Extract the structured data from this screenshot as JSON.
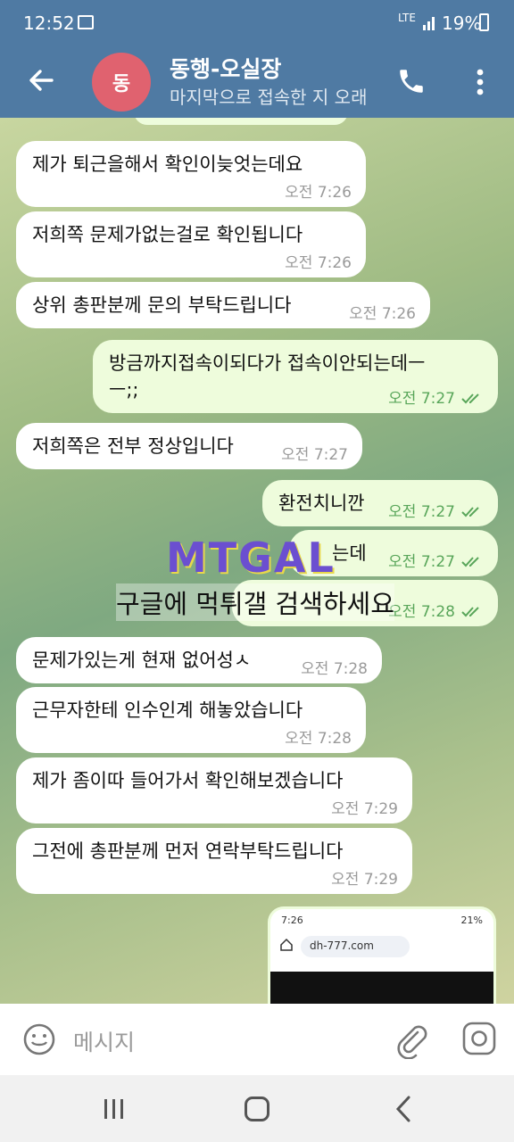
{
  "status_bar": {
    "time": "12:52",
    "network": "LTE",
    "battery": "19%"
  },
  "header": {
    "avatar_letter": "동",
    "title": "동행-오실장",
    "subtitle": "마지막으로 접속한 지 오래"
  },
  "messages": [
    {
      "dir": "in",
      "text": "제가 퇴근을해서 확인이늦엇는데요",
      "time": "오전 7:26"
    },
    {
      "dir": "in",
      "text": "저희쪽 문제가없는걸로 확인됩니다",
      "time": "오전 7:26"
    },
    {
      "dir": "in",
      "text": "상위 총판분께 문의 부탁드립니다",
      "time": "오전 7:26"
    },
    {
      "dir": "out",
      "text": "방금까지접속이되다가 접속이안되는데ㅡ",
      "text2": "ㅡ;;",
      "time": "오전 7:27"
    },
    {
      "dir": "in",
      "text": "저희쪽은 전부 정상입니다",
      "time": "오전 7:27"
    },
    {
      "dir": "out",
      "text": "환전치니깐",
      "time": "오전 7:27"
    },
    {
      "dir": "out",
      "text": "는데",
      "time": "오전 7:27"
    },
    {
      "dir": "out",
      "text": "",
      "time": "오전 7:28"
    },
    {
      "dir": "in",
      "text": "문제가있는게 현재 없어성ㅅ",
      "time": "오전 7:28"
    },
    {
      "dir": "in",
      "text": "근무자한테 인수인계 해놓았습니다",
      "time": "오전 7:28"
    },
    {
      "dir": "in",
      "text": "제가 좀이따 들어가서 확인해보겠습니다",
      "time": "오전 7:29"
    },
    {
      "dir": "in",
      "text": "그전에 총판분께 먼저 연락부탁드립니다",
      "time": "오전 7:29"
    }
  ],
  "watermark": {
    "logo": "MTGAL",
    "text": "구글에 먹튀갤 검색하세요"
  },
  "thumbnail": {
    "time": "7:26",
    "battery": "21%",
    "url": "dh-777.com"
  },
  "composer": {
    "placeholder": "메시지"
  },
  "colors": {
    "header": "#4f7aa3",
    "avatar": "#e0626f",
    "outgoing_bubble": "#eefcdc",
    "check": "#59a65a"
  }
}
